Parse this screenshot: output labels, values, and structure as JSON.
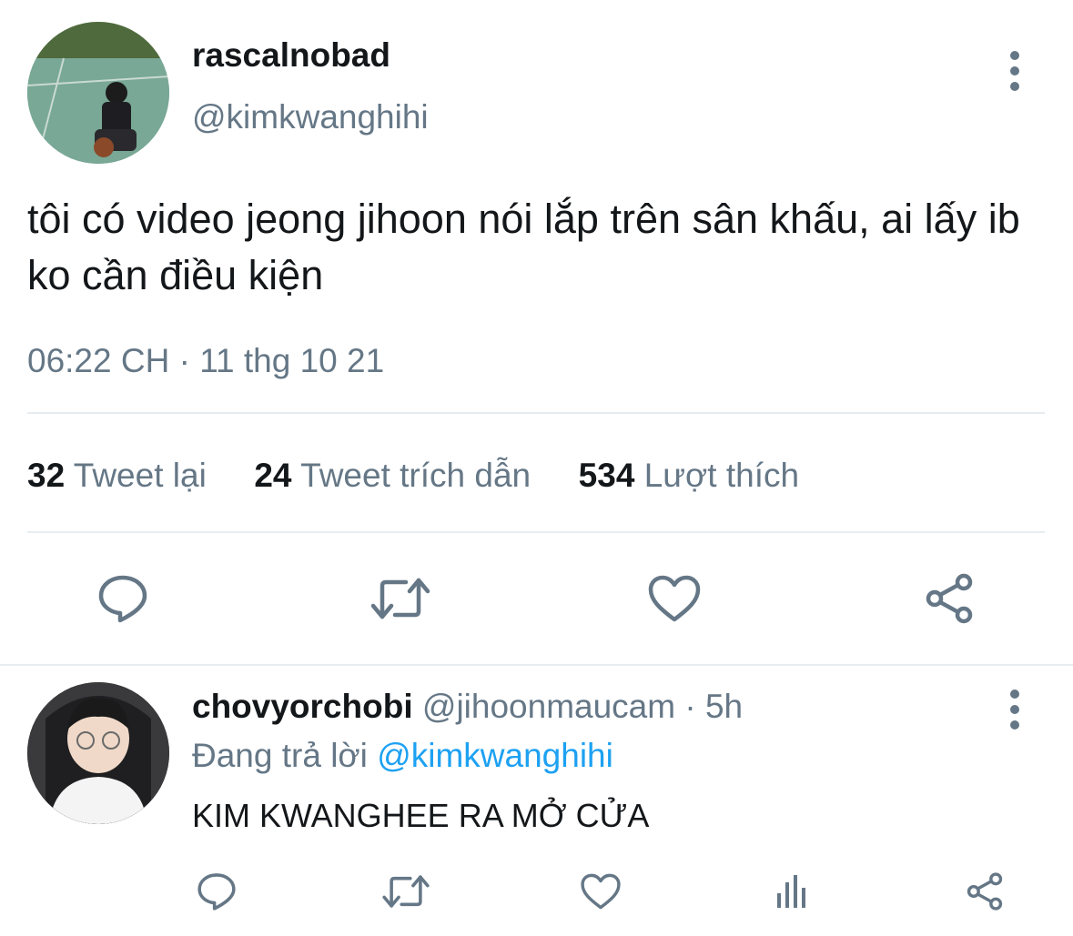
{
  "tweet": {
    "display_name": "rascalnobad",
    "handle": "@kimkwanghihi",
    "text": "tôi có video jeong jihoon nói lắp trên sân khấu, ai lấy ib ko cần điều kiện",
    "time": "06:22 CH",
    "separator": "·",
    "date": "11 thg 10 21",
    "stats": {
      "retweets_count": "32",
      "retweets_label": "Tweet lại",
      "quotes_count": "24",
      "quotes_label": "Tweet trích dẫn",
      "likes_count": "534",
      "likes_label": "Lượt thích"
    }
  },
  "reply": {
    "display_name": "chovyorchobi",
    "handle": "@jihoonmaucam",
    "separator": "·",
    "age": "5h",
    "replying_prefix": "Đang trả lời",
    "replying_to": "@kimkwanghihi",
    "text": "KIM KWANGHEE RA MỞ CỬA"
  },
  "icons": {
    "reply": "reply-icon",
    "retweet": "retweet-icon",
    "like": "heart-icon",
    "share": "share-icon",
    "analytics": "analytics-icon",
    "more": "more-vertical-icon"
  },
  "colors": {
    "text": "#14171a",
    "secondary": "#657786",
    "link": "#1da1f2",
    "divider": "#e6ecf0"
  }
}
